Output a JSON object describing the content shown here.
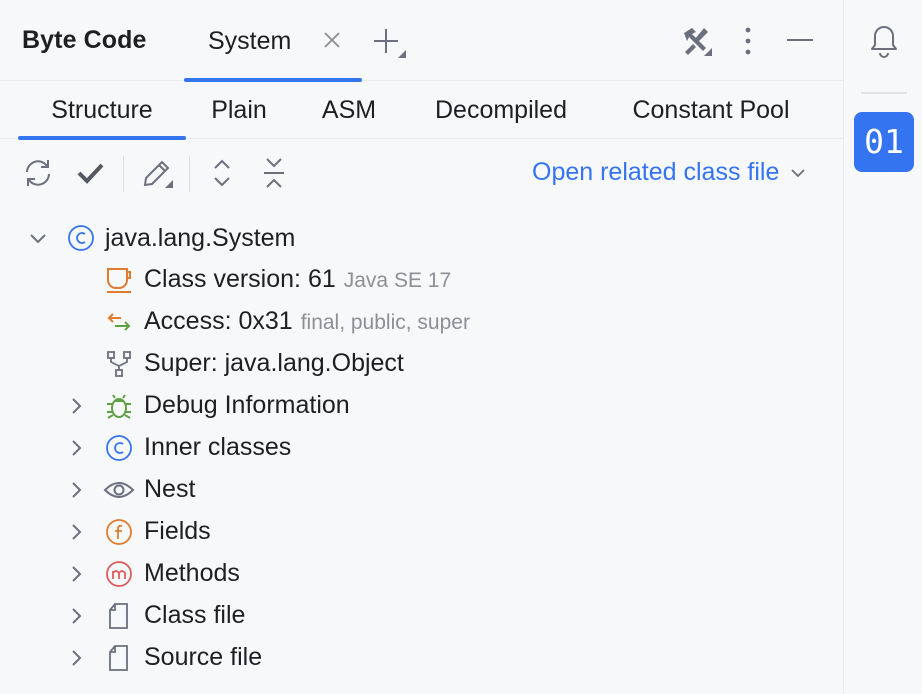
{
  "header": {
    "title": "Byte Code",
    "active_tab": "System"
  },
  "view_tabs": [
    "Structure",
    "Plain",
    "ASM",
    "Decompiled",
    "Constant Pool"
  ],
  "toolbar": {
    "related_link": "Open related class file"
  },
  "tree": {
    "root": {
      "label": "java.lang.System",
      "icon": "class-icon",
      "expanded": true
    },
    "items": [
      {
        "label": "Class version: 61",
        "detail": "Java SE 17",
        "icon": "cup-icon"
      },
      {
        "label": "Access: 0x31",
        "detail": "final, public, super",
        "icon": "access-arrows-icon"
      },
      {
        "label": "Super: java.lang.Object",
        "detail": "",
        "icon": "hierarchy-icon"
      },
      {
        "label": "Debug Information",
        "icon": "bug-icon"
      },
      {
        "label": "Inner classes",
        "icon": "class-icon"
      },
      {
        "label": "Nest",
        "icon": "eye-icon"
      },
      {
        "label": "Fields",
        "icon": "field-icon"
      },
      {
        "label": "Methods",
        "icon": "method-icon"
      },
      {
        "label": "Class file",
        "icon": "file-icon"
      },
      {
        "label": "Source file",
        "icon": "file-icon"
      }
    ]
  },
  "right_strip": {
    "bytecode_button": "01"
  },
  "colors": {
    "accent": "#3574f0",
    "orange": "#e07b30",
    "green": "#5fa045",
    "red": "#db5c5c",
    "gray_text": "#8c8f96"
  }
}
